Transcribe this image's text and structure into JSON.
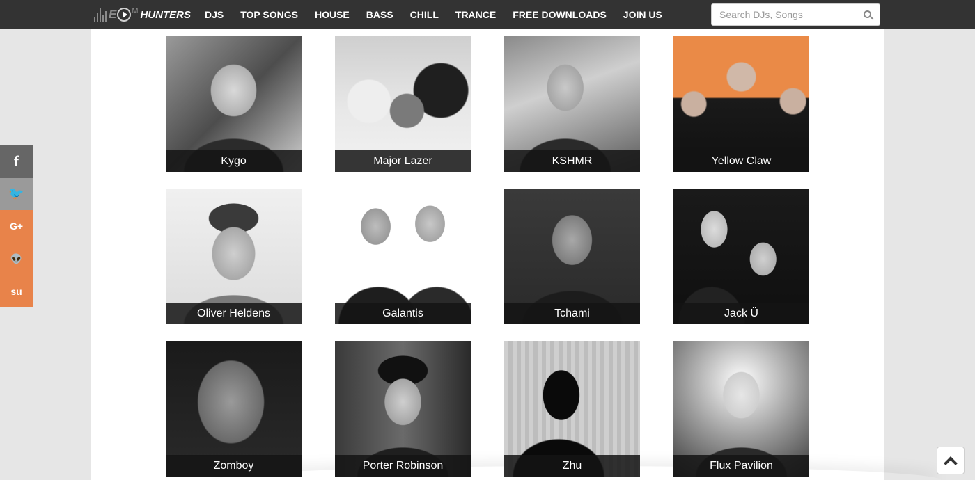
{
  "header": {
    "logo_text": "HUNTERS",
    "nav": [
      "DJS",
      "TOP SONGS",
      "HOUSE",
      "BASS",
      "CHILL",
      "TRANCE",
      "FREE DOWNLOADS",
      "JOIN US"
    ],
    "search_placeholder": "Search DJs, Songs"
  },
  "artists": [
    "Kygo",
    "Major Lazer",
    "KSHMR",
    "Yellow Claw",
    "Oliver Heldens",
    "Galantis",
    "Tchami",
    "Jack Ü",
    "Zomboy",
    "Porter Robinson",
    "Zhu",
    "Flux Pavilion"
  ],
  "social": {
    "facebook": "f",
    "twitter": "🐦",
    "googleplus": "G+",
    "reddit": "👽",
    "stumbleupon": "su"
  },
  "icons": {
    "search": "search-icon",
    "scroll_top": "chevron-up-icon"
  },
  "colors": {
    "nav_bg": "#333333",
    "social_orange": "#e8834a",
    "caption_bg": "#141414"
  }
}
